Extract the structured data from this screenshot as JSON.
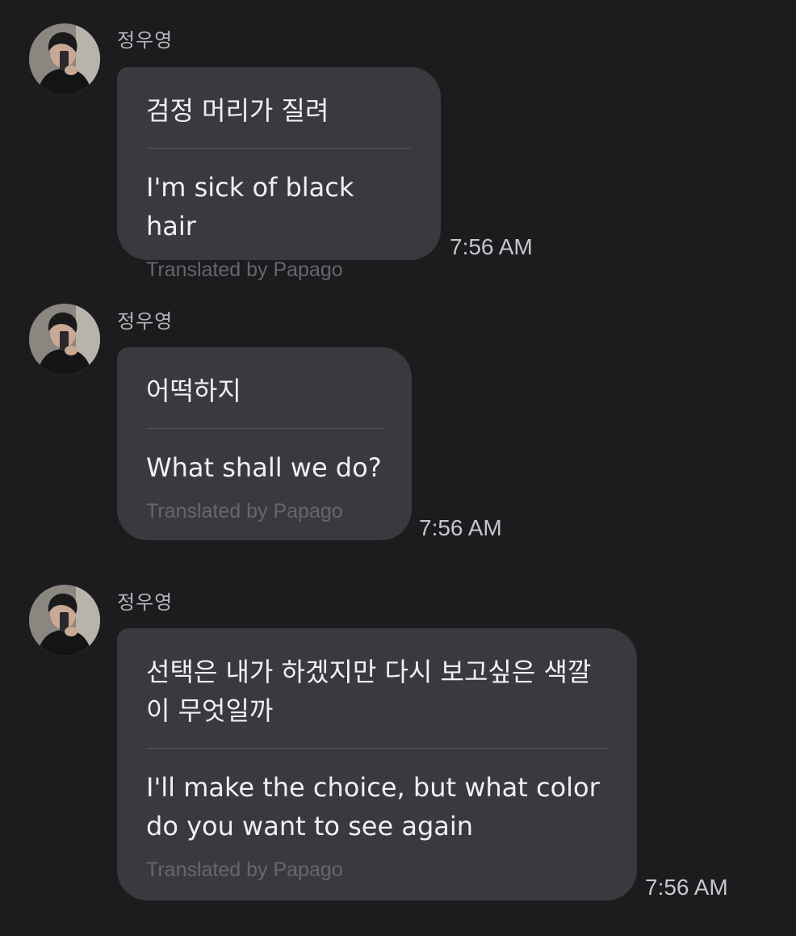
{
  "messages": [
    {
      "sender": "정우영",
      "original": "검정 머리가 질려",
      "translation": "I'm sick of black hair",
      "credit": "Translated by Papago",
      "time": "7:56 AM"
    },
    {
      "sender": "정우영",
      "original": "어떡하지",
      "translation": "What shall we do?",
      "credit": "Translated by Papago",
      "time": "7:56 AM"
    },
    {
      "sender": "정우영",
      "original": "선택은 내가 하겠지만 다시 보고싶은 색깔이 무엇일까",
      "translation": "I'll make the choice, but what color do you want to see again",
      "credit": "Translated by Papago",
      "time": "7:56 AM"
    }
  ],
  "colors": {
    "background": "#1c1c1e",
    "bubble": "#3a3a3e",
    "divider": "#55555b",
    "sender": "#b4b4ba",
    "credit": "#66666c",
    "time": "#c6c6cc"
  }
}
